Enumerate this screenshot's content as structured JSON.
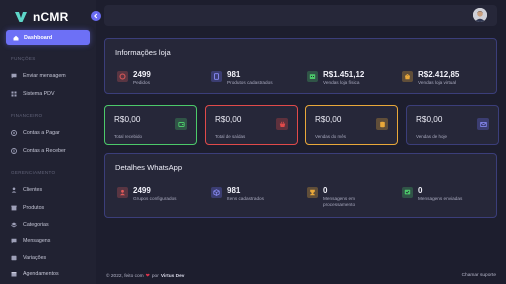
{
  "app": {
    "name": "nCMR"
  },
  "sidebar": {
    "active": {
      "label": "Dashboard",
      "icon": "home-icon"
    },
    "sections": [
      {
        "title": "FUNÇÕES",
        "items": [
          {
            "label": "Enviar mensagem",
            "icon": "message-icon"
          },
          {
            "label": "Sistema PDV",
            "icon": "grid-icon"
          }
        ]
      },
      {
        "title": "FINANCEIRO",
        "items": [
          {
            "label": "Contas a Pagar",
            "icon": "coin-out-icon"
          },
          {
            "label": "Contas a Receber",
            "icon": "coin-in-icon"
          }
        ]
      },
      {
        "title": "GERENCIAMENTO",
        "items": [
          {
            "label": "Clientes",
            "icon": "user-icon"
          },
          {
            "label": "Produtos",
            "icon": "box-icon"
          },
          {
            "label": "Categorias",
            "icon": "layers-icon"
          },
          {
            "label": "Mensagens",
            "icon": "chat-icon"
          },
          {
            "label": "Variações",
            "icon": "shuffle-icon"
          },
          {
            "label": "Agendamentos",
            "icon": "calendar-icon"
          }
        ]
      }
    ]
  },
  "info_loja": {
    "title": "Informações loja",
    "stats": [
      {
        "value": "2499",
        "label": "Pedidos",
        "icon": "tag-icon",
        "color": "#e05a5a"
      },
      {
        "value": "981",
        "label": "Produtos cadastrados",
        "icon": "tablet-icon",
        "color": "#6d70f6"
      },
      {
        "value": "R$1.451,12",
        "label": "Vendas loja física",
        "icon": "store-icon",
        "color": "#4cc96a"
      },
      {
        "value": "R$2.412,85",
        "label": "Vendas loja virtual",
        "icon": "bag-icon",
        "color": "#e9a83a"
      }
    ]
  },
  "cards": [
    {
      "value": "R$0,00",
      "label": "Total recebido",
      "icon": "wallet-icon",
      "color": "#4cc96a"
    },
    {
      "value": "R$0,00",
      "label": "Total de saídas",
      "icon": "basket-icon",
      "color": "#e04a4a"
    },
    {
      "value": "R$0,00",
      "label": "Vendas do mês",
      "icon": "coins-icon",
      "color": "#e9a83a"
    },
    {
      "value": "R$0,00",
      "label": "Vendas de hoje",
      "icon": "mail-icon",
      "color": "#6d70f6"
    }
  ],
  "whatsapp": {
    "title": "Detalhes WhatsApp",
    "stats": [
      {
        "value": "2499",
        "label": "Grupos configurados",
        "icon": "users-icon",
        "color": "#e05a5a"
      },
      {
        "value": "981",
        "label": "Itens cadastrados",
        "icon": "cube-icon",
        "color": "#6d70f6"
      },
      {
        "value": "0",
        "label": "Mensagens em",
        "label2": "processamento",
        "icon": "hourglass-icon",
        "color": "#e9a83a"
      },
      {
        "value": "0",
        "label": "Mensagens enviadas",
        "icon": "check-chat-icon",
        "color": "#4cc96a"
      }
    ]
  },
  "footer": {
    "copyright": "© 2022, feito com",
    "by": "por",
    "author": "Virtus Dev",
    "support": "Chamar suporte"
  }
}
